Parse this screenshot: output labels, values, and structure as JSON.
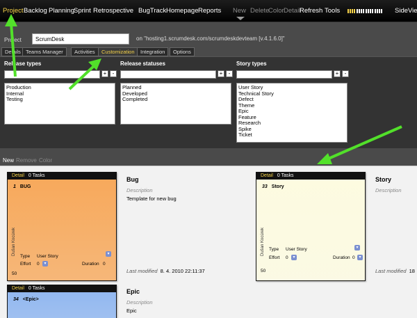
{
  "menu": {
    "items": [
      "Project",
      "Backlog",
      "Planning",
      "Sprint",
      "Retrospective",
      "BugTrack",
      "Homepage",
      "Reports"
    ],
    "active": "Project",
    "actions": {
      "new": "New",
      "delete": "Delete",
      "color": "Color",
      "detail": "Detail",
      "refresh": "Refresh",
      "tools": "Tools"
    },
    "right_label": "SideView"
  },
  "project": {
    "label": "Project",
    "name": "ScrumDesk",
    "url_text": "on \"hosting1.scrumdesk.com/scrumdeskdevteam [v.4.1.6.0]\""
  },
  "tabs": [
    "Details",
    "Teams Manager",
    "Activities",
    "Customization",
    "Integration",
    "Options"
  ],
  "active_tab": "Customization",
  "config": {
    "release_types": {
      "title": "Release types",
      "items": [
        "Production",
        "Internal",
        "Testing"
      ]
    },
    "release_statuses": {
      "title": "Release statuses",
      "items": [
        "Planned",
        "Developed",
        "Completed"
      ]
    },
    "story_types": {
      "title": "Story types",
      "items": [
        "User Story",
        "Technical Story",
        "Defect",
        "Theme",
        "Epic",
        "Feature",
        "Research",
        "Spike",
        "Ticket"
      ]
    }
  },
  "card_actions": {
    "new": "New",
    "remove": "Remove",
    "color": "Color"
  },
  "cards": [
    {
      "id": "1",
      "title": "BUG",
      "detail": "Detail",
      "tasks": "0 Tasks",
      "author": "Dušan Kocúrek",
      "type_label": "Type",
      "type_value": "User Story",
      "effort_label": "Effort",
      "effort_value": "0",
      "duration_label": "Duration",
      "duration_value": "0",
      "points": "50",
      "color": "#f7a85a",
      "info_title": "Bug",
      "desc_label": "Description",
      "desc_value": "Template for new bug",
      "modified_label": "Last modified",
      "modified_value": "8. 4. 2010 22:11:37"
    },
    {
      "id": "33",
      "title": "Story",
      "detail": "Detail",
      "tasks": "0 Tasks",
      "author": "Dušan Kocúrek",
      "type_label": "Type",
      "type_value": "User Story",
      "effort_label": "Effort",
      "effort_value": "0",
      "duration_label": "Duration",
      "duration_value": "0",
      "points": "50",
      "color": "#fdfbe0",
      "info_title": "Story",
      "desc_label": "Description",
      "desc_value": "",
      "modified_label": "Last modified",
      "modified_value": "18"
    },
    {
      "id": "34",
      "title": "<Epic>",
      "detail": "Detail",
      "tasks": "0 Tasks",
      "color": "#8fb6f0",
      "info_title": "Epic",
      "desc_label": "Description",
      "desc_value": "Epic"
    }
  ],
  "colors": {
    "accent": "#f6d34a",
    "arrow": "#52e02a"
  }
}
